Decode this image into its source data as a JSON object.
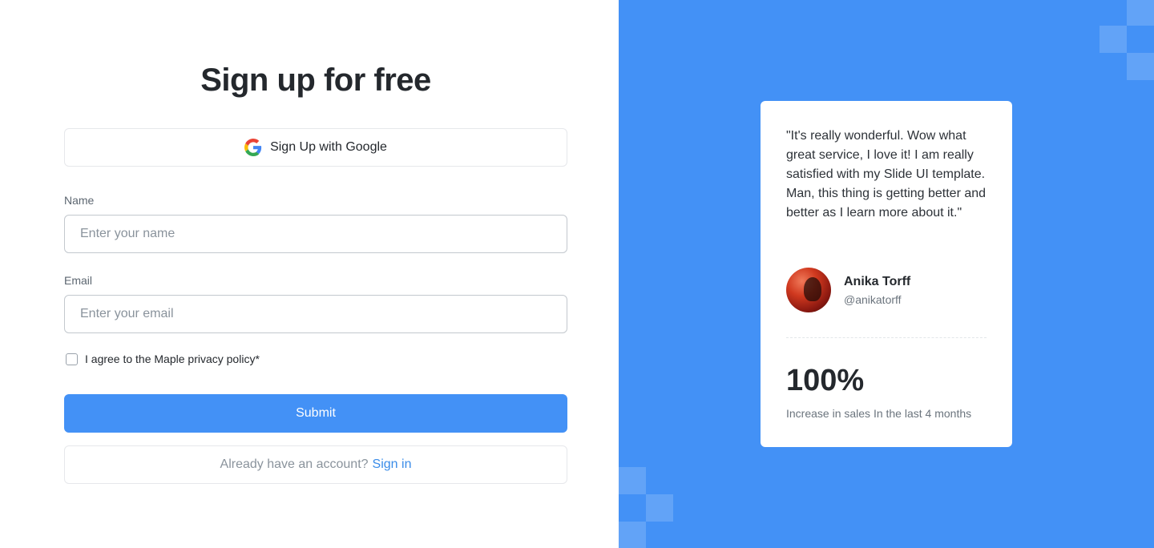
{
  "signup": {
    "title": "Sign up for free",
    "google_button_label": "Sign Up with Google",
    "name_label": "Name",
    "name_placeholder": "Enter your name",
    "name_value": "",
    "email_label": "Email",
    "email_placeholder": "Enter your email",
    "email_value": "",
    "agree_label": "I agree to the Maple privacy policy*",
    "agree_checked": false,
    "submit_label": "Submit",
    "signin_prompt": "Already have an account?",
    "signin_link": "Sign in"
  },
  "testimonial": {
    "quote": "\"It's really wonderful. Wow what great service, I love it! I am really satisfied with my Slide UI template. Man, this thing is getting better and better as I learn more about it.\"",
    "author_name": "Anika Torff",
    "author_handle": "@anikatorff",
    "stat_value": "100%",
    "stat_label": "Increase in sales In the last 4 months"
  },
  "colors": {
    "accent": "#4391f6",
    "link": "#3a8ce8"
  },
  "icons": {
    "google": "google-g-icon",
    "avatar": "author-avatar"
  }
}
